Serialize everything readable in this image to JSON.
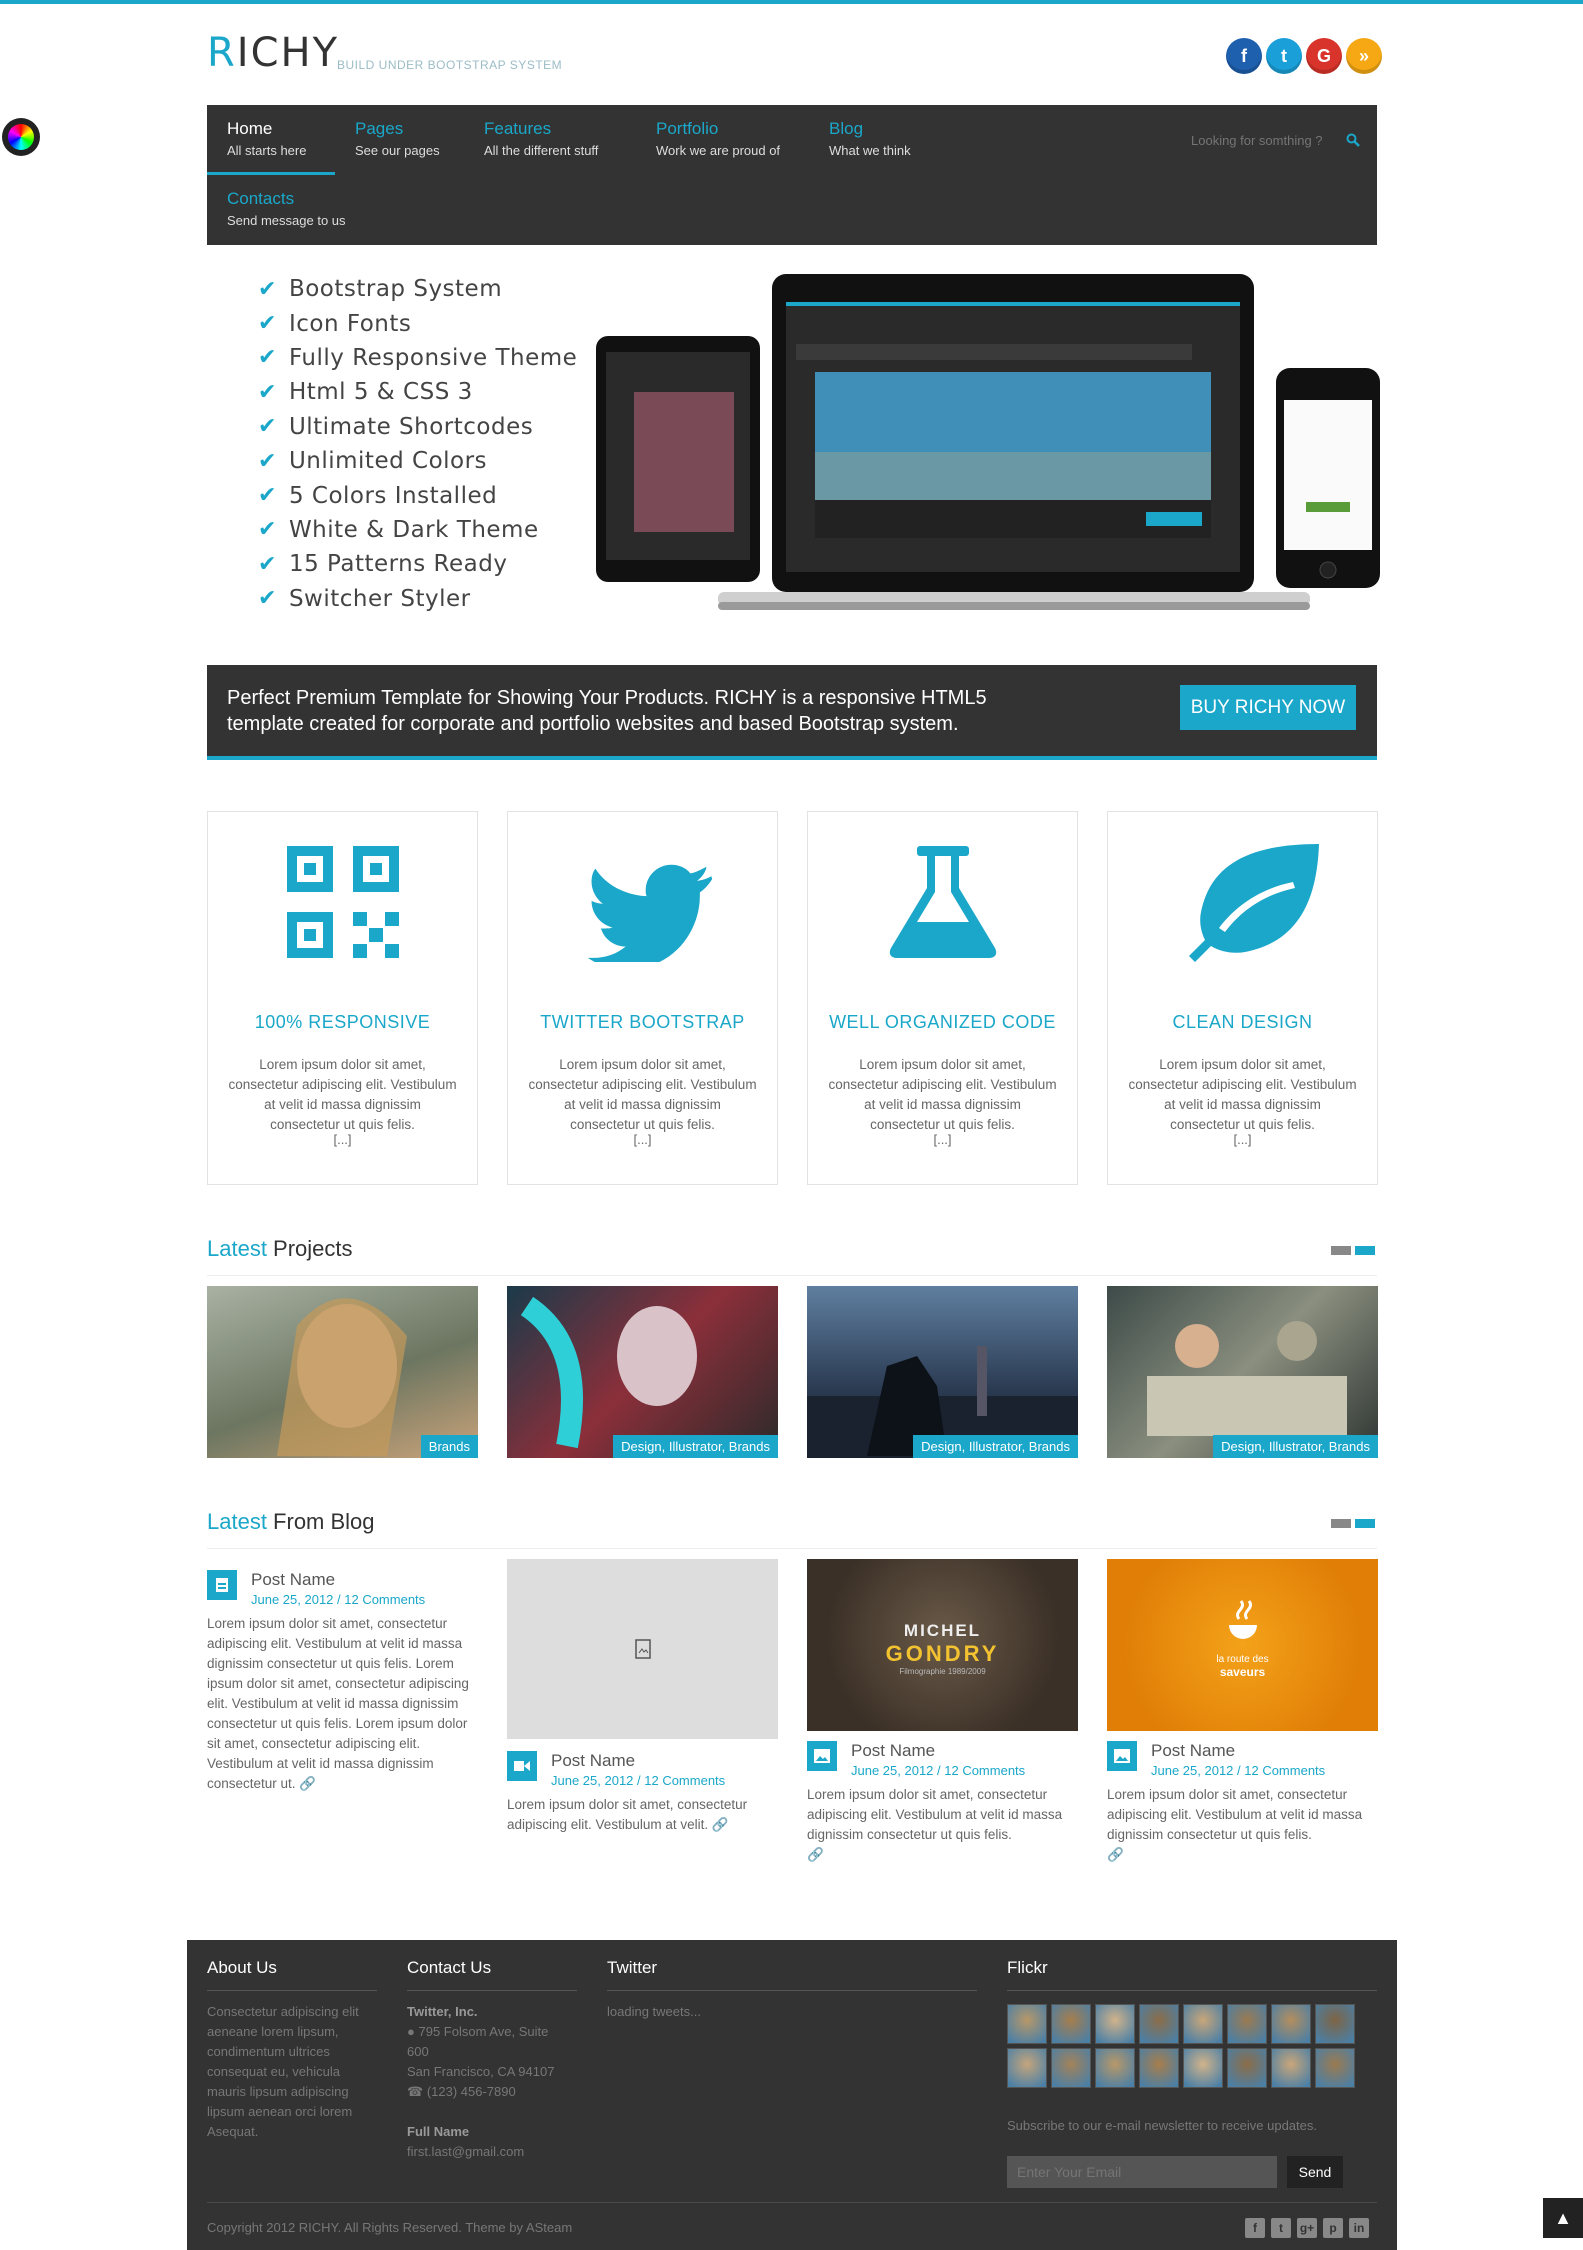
{
  "header": {
    "logo_first": "R",
    "logo_rest": "ICHY",
    "tagline": "BUILD UNDER BOOTSTRAP SYSTEM",
    "social": [
      {
        "icon": "facebook-icon",
        "glyph": "f",
        "color": "#1e5fae"
      },
      {
        "icon": "twitter-icon",
        "glyph": "t",
        "color": "#1a9fd8"
      },
      {
        "icon": "google-plus-icon",
        "glyph": "G",
        "color": "#d9342b"
      },
      {
        "icon": "rss-icon",
        "glyph": "»",
        "color": "#f5a814"
      }
    ]
  },
  "nav": {
    "items": [
      {
        "title": "Home",
        "sub": "All starts here"
      },
      {
        "title": "Pages",
        "sub": "See our pages"
      },
      {
        "title": "Features",
        "sub": "All the different stuff"
      },
      {
        "title": "Portfolio",
        "sub": "Work we are proud of"
      },
      {
        "title": "Blog",
        "sub": "What we think"
      },
      {
        "title": "Contacts",
        "sub": "Send message to us"
      }
    ],
    "search_placeholder": "Looking for somthing ?"
  },
  "hero": {
    "features": [
      "Bootstrap System",
      "Icon Fonts",
      "Fully Responsive Theme",
      "Html 5 & CSS 3",
      "Ultimate Shortcodes",
      "Unlimited Colors",
      "5 Colors Installed",
      "White & Dark Theme",
      "15 Patterns Ready",
      "Switcher Styler"
    ]
  },
  "promo": {
    "text": "Perfect Premium Template for Showing Your Products. RICHY is a responsive HTML5 template created for corporate and portfolio websites and based Bootstrap system.",
    "button": "BUY RICHY NOW"
  },
  "features": [
    {
      "icon": "qr-code-icon",
      "title": "100% RESPONSIVE",
      "text": "Lorem ipsum dolor sit amet, consectetur adipiscing elit. Vestibulum at velit id massa dignissim consectetur ut quis felis.",
      "more": "[...]"
    },
    {
      "icon": "twitter-bird-icon",
      "title": "TWITTER BOOTSTRAP",
      "text": "Lorem ipsum dolor sit amet, consectetur adipiscing elit. Vestibulum at velit id massa dignissim consectetur ut quis felis.",
      "more": "[...]"
    },
    {
      "icon": "flask-icon",
      "title": "WELL ORGANIZED CODE",
      "text": "Lorem ipsum dolor sit amet, consectetur adipiscing elit. Vestibulum at velit id massa dignissim consectetur ut quis felis.",
      "more": "[...]"
    },
    {
      "icon": "leaf-icon",
      "title": "CLEAN DESIGN",
      "text": "Lorem ipsum dolor sit amet, consectetur adipiscing elit. Vestibulum at velit id massa dignissim consectetur ut quis felis.",
      "more": "[...]"
    }
  ],
  "projects": {
    "head_hl": "Latest",
    "head_rest": " Projects",
    "items": [
      {
        "tag": "Brands"
      },
      {
        "tag": "Design, Illustrator, Brands"
      },
      {
        "tag": "Design, Illustrator, Brands"
      },
      {
        "tag": "Design, Illustrator, Brands"
      }
    ]
  },
  "blog": {
    "head_hl": "Latest",
    "head_rest": " From Blog",
    "posts": [
      {
        "name": "Post Name",
        "date": "June 25, 2012 / 12 Comments",
        "text": "Lorem ipsum dolor sit amet, consectetur adipiscing elit. Vestibulum at velit id massa dignissim consectetur ut quis felis. Lorem ipsum dolor sit amet, consectetur adipiscing elit. Vestibulum at velit id massa dignissim consectetur ut quis felis. Lorem ipsum dolor sit amet, consectetur adipiscing elit. Vestibulum at velit id massa dignissim consectetur ut."
      },
      {
        "name": "Post Name",
        "date": "June 25, 2012 / 12 Comments",
        "text": "Lorem ipsum dolor sit amet, consectetur adipiscing elit. Vestibulum at velit."
      },
      {
        "name": "Post Name",
        "date": "June 25, 2012 / 12 Comments",
        "text": "Lorem ipsum dolor sit amet, consectetur adipiscing elit. Vestibulum at velit id massa dignissim consectetur ut quis felis.",
        "image_text_1": "MICHEL",
        "image_text_2": "GONDRY",
        "image_text_3": "Filmographie 1989/2009"
      },
      {
        "name": "Post Name",
        "date": "June 25, 2012 / 12 Comments",
        "text": "Lorem ipsum dolor sit amet, consectetur adipiscing elit. Vestibulum at velit id massa dignissim consectetur ut quis felis.",
        "image_text_1": "la route des",
        "image_text_2": "saveurs"
      }
    ]
  },
  "footer": {
    "about_title": "About Us",
    "about_text": "Consectetur adipiscing elit aeneane lorem lipsum, condimentum ultrices consequat eu, vehicula mauris lipsum adipiscing lipsum aenean orci lorem Asequat.",
    "contact_title": "Contact Us",
    "company": "Twitter, Inc.",
    "address": "795 Folsom Ave, Suite 600",
    "city": "San Francisco, CA 94107",
    "phone": "(123) 456-7890",
    "full_name": "Full Name",
    "email": "first.last@gmail.com",
    "twitter_title": "Twitter",
    "twitter_text": "loading tweets...",
    "flickr_title": "Flickr",
    "newsletter_text": "Subscribe to our e-mail newsletter to receive updates.",
    "email_placeholder": "Enter Your Email",
    "send": "Send",
    "copyright": "Copyright 2012 RICHY. All Rights Reserved. Theme by ASteam",
    "social": [
      "f",
      "t",
      "g+",
      "p",
      "in"
    ]
  },
  "colors": {
    "accent": "#1aa7c9",
    "dark": "#333333"
  }
}
